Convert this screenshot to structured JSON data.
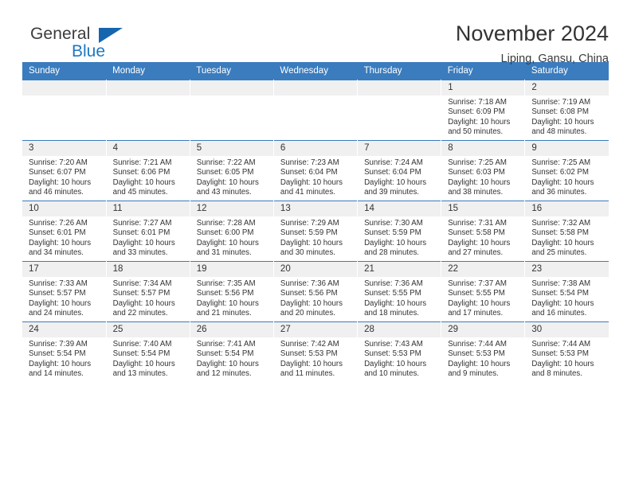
{
  "brand": {
    "name_part1": "General",
    "name_part2": "Blue",
    "logo_icon": "triangle-flag-icon"
  },
  "header": {
    "month_title": "November 2024",
    "location": "Liping, Gansu, China"
  },
  "calendar": {
    "weekday_headers": [
      "Sunday",
      "Monday",
      "Tuesday",
      "Wednesday",
      "Thursday",
      "Friday",
      "Saturday"
    ],
    "accent_color": "#3a7cbe",
    "daynum_bg": "#f0f0f0",
    "weeks": [
      [
        {
          "day": "",
          "empty": true
        },
        {
          "day": "",
          "empty": true
        },
        {
          "day": "",
          "empty": true
        },
        {
          "day": "",
          "empty": true
        },
        {
          "day": "",
          "empty": true
        },
        {
          "day": "1",
          "sunrise": "Sunrise: 7:18 AM",
          "sunset": "Sunset: 6:09 PM",
          "daylight": "Daylight: 10 hours and 50 minutes."
        },
        {
          "day": "2",
          "sunrise": "Sunrise: 7:19 AM",
          "sunset": "Sunset: 6:08 PM",
          "daylight": "Daylight: 10 hours and 48 minutes."
        }
      ],
      [
        {
          "day": "3",
          "sunrise": "Sunrise: 7:20 AM",
          "sunset": "Sunset: 6:07 PM",
          "daylight": "Daylight: 10 hours and 46 minutes."
        },
        {
          "day": "4",
          "sunrise": "Sunrise: 7:21 AM",
          "sunset": "Sunset: 6:06 PM",
          "daylight": "Daylight: 10 hours and 45 minutes."
        },
        {
          "day": "5",
          "sunrise": "Sunrise: 7:22 AM",
          "sunset": "Sunset: 6:05 PM",
          "daylight": "Daylight: 10 hours and 43 minutes."
        },
        {
          "day": "6",
          "sunrise": "Sunrise: 7:23 AM",
          "sunset": "Sunset: 6:04 PM",
          "daylight": "Daylight: 10 hours and 41 minutes."
        },
        {
          "day": "7",
          "sunrise": "Sunrise: 7:24 AM",
          "sunset": "Sunset: 6:04 PM",
          "daylight": "Daylight: 10 hours and 39 minutes."
        },
        {
          "day": "8",
          "sunrise": "Sunrise: 7:25 AM",
          "sunset": "Sunset: 6:03 PM",
          "daylight": "Daylight: 10 hours and 38 minutes."
        },
        {
          "day": "9",
          "sunrise": "Sunrise: 7:25 AM",
          "sunset": "Sunset: 6:02 PM",
          "daylight": "Daylight: 10 hours and 36 minutes."
        }
      ],
      [
        {
          "day": "10",
          "sunrise": "Sunrise: 7:26 AM",
          "sunset": "Sunset: 6:01 PM",
          "daylight": "Daylight: 10 hours and 34 minutes."
        },
        {
          "day": "11",
          "sunrise": "Sunrise: 7:27 AM",
          "sunset": "Sunset: 6:01 PM",
          "daylight": "Daylight: 10 hours and 33 minutes."
        },
        {
          "day": "12",
          "sunrise": "Sunrise: 7:28 AM",
          "sunset": "Sunset: 6:00 PM",
          "daylight": "Daylight: 10 hours and 31 minutes."
        },
        {
          "day": "13",
          "sunrise": "Sunrise: 7:29 AM",
          "sunset": "Sunset: 5:59 PM",
          "daylight": "Daylight: 10 hours and 30 minutes."
        },
        {
          "day": "14",
          "sunrise": "Sunrise: 7:30 AM",
          "sunset": "Sunset: 5:59 PM",
          "daylight": "Daylight: 10 hours and 28 minutes."
        },
        {
          "day": "15",
          "sunrise": "Sunrise: 7:31 AM",
          "sunset": "Sunset: 5:58 PM",
          "daylight": "Daylight: 10 hours and 27 minutes."
        },
        {
          "day": "16",
          "sunrise": "Sunrise: 7:32 AM",
          "sunset": "Sunset: 5:58 PM",
          "daylight": "Daylight: 10 hours and 25 minutes."
        }
      ],
      [
        {
          "day": "17",
          "sunrise": "Sunrise: 7:33 AM",
          "sunset": "Sunset: 5:57 PM",
          "daylight": "Daylight: 10 hours and 24 minutes."
        },
        {
          "day": "18",
          "sunrise": "Sunrise: 7:34 AM",
          "sunset": "Sunset: 5:57 PM",
          "daylight": "Daylight: 10 hours and 22 minutes."
        },
        {
          "day": "19",
          "sunrise": "Sunrise: 7:35 AM",
          "sunset": "Sunset: 5:56 PM",
          "daylight": "Daylight: 10 hours and 21 minutes."
        },
        {
          "day": "20",
          "sunrise": "Sunrise: 7:36 AM",
          "sunset": "Sunset: 5:56 PM",
          "daylight": "Daylight: 10 hours and 20 minutes."
        },
        {
          "day": "21",
          "sunrise": "Sunrise: 7:36 AM",
          "sunset": "Sunset: 5:55 PM",
          "daylight": "Daylight: 10 hours and 18 minutes."
        },
        {
          "day": "22",
          "sunrise": "Sunrise: 7:37 AM",
          "sunset": "Sunset: 5:55 PM",
          "daylight": "Daylight: 10 hours and 17 minutes."
        },
        {
          "day": "23",
          "sunrise": "Sunrise: 7:38 AM",
          "sunset": "Sunset: 5:54 PM",
          "daylight": "Daylight: 10 hours and 16 minutes."
        }
      ],
      [
        {
          "day": "24",
          "sunrise": "Sunrise: 7:39 AM",
          "sunset": "Sunset: 5:54 PM",
          "daylight": "Daylight: 10 hours and 14 minutes."
        },
        {
          "day": "25",
          "sunrise": "Sunrise: 7:40 AM",
          "sunset": "Sunset: 5:54 PM",
          "daylight": "Daylight: 10 hours and 13 minutes."
        },
        {
          "day": "26",
          "sunrise": "Sunrise: 7:41 AM",
          "sunset": "Sunset: 5:54 PM",
          "daylight": "Daylight: 10 hours and 12 minutes."
        },
        {
          "day": "27",
          "sunrise": "Sunrise: 7:42 AM",
          "sunset": "Sunset: 5:53 PM",
          "daylight": "Daylight: 10 hours and 11 minutes."
        },
        {
          "day": "28",
          "sunrise": "Sunrise: 7:43 AM",
          "sunset": "Sunset: 5:53 PM",
          "daylight": "Daylight: 10 hours and 10 minutes."
        },
        {
          "day": "29",
          "sunrise": "Sunrise: 7:44 AM",
          "sunset": "Sunset: 5:53 PM",
          "daylight": "Daylight: 10 hours and 9 minutes."
        },
        {
          "day": "30",
          "sunrise": "Sunrise: 7:44 AM",
          "sunset": "Sunset: 5:53 PM",
          "daylight": "Daylight: 10 hours and 8 minutes."
        }
      ]
    ]
  }
}
